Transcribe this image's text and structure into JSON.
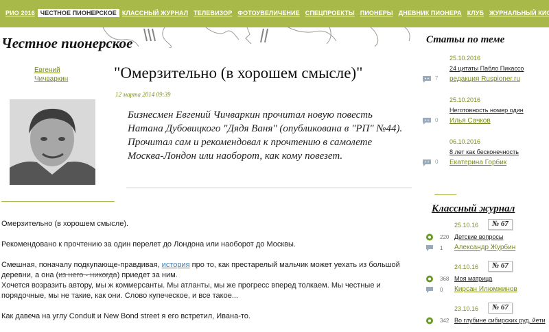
{
  "nav": {
    "items": [
      "РИО 2016",
      "ЧЕСТНОЕ ПИОНЕРСКОЕ",
      "КЛАССНЫЙ ЖУРНАЛ",
      "ТЕЛЕВИЗОР",
      "ФОТОУВЕЛИЧЕНИЕ",
      "СПЕЦПРОЕКТЫ",
      "ПИОНЕРЫ",
      "ДНЕВНИК ПИОНЕРА",
      "КЛУБ",
      "ЖУРНАЛЬНЫЙ КИОСК"
    ],
    "active": "ЧЕСТНОЕ ПИОНЕРСКОЕ"
  },
  "section_title": "Честное пионерское",
  "author": {
    "first": "Евгений",
    "last": "Чичваркин"
  },
  "article": {
    "title": "\"Омерзительно (в хорошем смысле)\"",
    "date": "12 марта 2014 09:39",
    "lead": "Бизнесмен Евгений Чичваркин прочитал новую повесть Натана Дубовицкого \"Дядя Ваня\" (опубликована в \"РП\" №44). Прочитал сам и рекомендовал к прочтению в самолете Москва-Лондон или наоборот, как кому повезет.",
    "p1": "Омерзительно (в хорошем смысле).",
    "p2": "Рекомендовано к прочтению за один перелет до Лондона или наоборот до Москвы.",
    "p3_a": "Смешная, поначалу подкупающе-правдивая, ",
    "p3_link": "история",
    "p3_b": " про то, как престарелый мальчик может уехать из большой деревни, а она (",
    "p3_strike": "из него - никогда",
    "p3_c": ") приедет за ним.",
    "p3_d": "Хочется возразить автору, мы ж коммерсанты. Мы атланты, мы же прогресс вперед толкаем. Мы честные и порядочные, мы не такие, как они. Слово купеческое, и все такое...",
    "p4": "Как давеча на углу Conduit и New Bond street я его встретил, Ивана-то."
  },
  "related": {
    "title": "Статьи по теме",
    "items": [
      {
        "date": "25.10.2016",
        "title": "24 цитаты Пабло Пикассо",
        "author": "редакция Ruspioner.ru",
        "comments": "7"
      },
      {
        "date": "25.10.2016",
        "title": "Неготовность номер один",
        "author": "Илья Сачков",
        "comments": "0"
      },
      {
        "date": "06.10.2016",
        "title": "8 лет как бесконечность",
        "author": "Екатерина Горбик",
        "comments": "0"
      }
    ]
  },
  "journal": {
    "title": "Классный журнал",
    "items": [
      {
        "date": "25.10.16",
        "issue": "№ 67",
        "title": "Детские вопросы",
        "views": "220",
        "author": "Александр Журбин",
        "comments": "1"
      },
      {
        "date": "24.10.16",
        "issue": "№ 67",
        "title": "Моя матрица",
        "views": "368",
        "author": "Кирсан Илюмжинов",
        "comments": "0"
      },
      {
        "date": "23.10.16",
        "issue": "№ 67",
        "title": "Во глубине сибирских руд, йети",
        "views": "342",
        "author": "",
        "comments": ""
      }
    ]
  },
  "colors": {
    "accent": "#a8b94a",
    "accent_text": "#7a8a1a",
    "link": "#3a7ab8"
  }
}
